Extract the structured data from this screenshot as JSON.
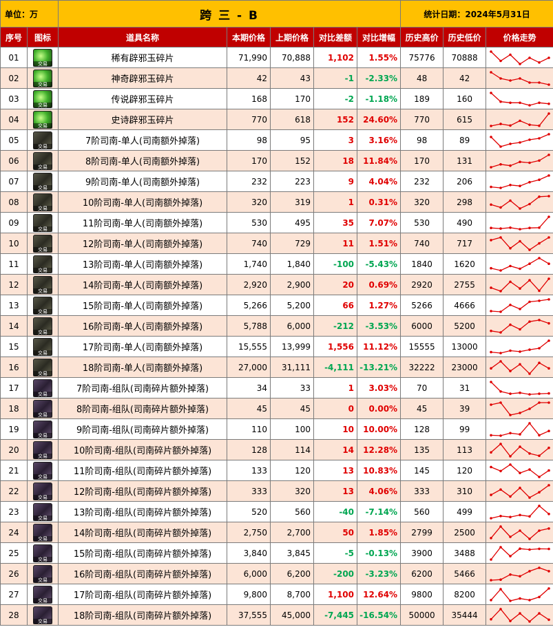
{
  "header": {
    "unit": "单位：万",
    "title": "跨 三 - B",
    "date": "统计日期：2024年5月31日"
  },
  "columns": [
    "序号",
    "图标",
    "道具名称",
    "本期价格",
    "上期价格",
    "对比差额",
    "对比增幅",
    "历史高价",
    "历史低价",
    "价格走势"
  ],
  "icon_label": "交易",
  "colors": {
    "header_bg": "#ffc000",
    "column_header_bg": "#c00000",
    "even_row_bg": "#fce4d6",
    "positive": "#e00000",
    "negative": "#00a651",
    "sparkline": "#e00000"
  },
  "rows": [
    {
      "no": "01",
      "icon": "gem-icon",
      "name": "稀有辟邪玉碎片",
      "cur": "71,990",
      "prev": "70,888",
      "diff": "1,102",
      "pct": "1.55%",
      "high": "75776",
      "low": "70888",
      "sign": "pos",
      "trend": [
        74,
        71,
        73,
        70,
        72,
        70.5,
        72
      ]
    },
    {
      "no": "02",
      "icon": "gem-icon",
      "name": "神奇辟邪玉碎片",
      "cur": "42",
      "prev": "43",
      "diff": "-1",
      "pct": "-2.33%",
      "high": "48",
      "low": "42",
      "sign": "neg",
      "trend": [
        48,
        45,
        44,
        45,
        43,
        43,
        42
      ]
    },
    {
      "no": "03",
      "icon": "gem-icon",
      "name": "传说辟邪玉碎片",
      "cur": "168",
      "prev": "170",
      "diff": "-2",
      "pct": "-1.18%",
      "high": "189",
      "low": "160",
      "sign": "neg",
      "trend": [
        189,
        172,
        170,
        170,
        165,
        170,
        168
      ]
    },
    {
      "no": "04",
      "icon": "gem-icon",
      "name": "史诗辟邪玉碎片",
      "cur": "770",
      "prev": "618",
      "diff": "152",
      "pct": "24.60%",
      "high": "770",
      "low": "615",
      "sign": "pos",
      "trend": [
        615,
        640,
        620,
        680,
        630,
        618,
        770
      ]
    },
    {
      "no": "05",
      "icon": "card-icon",
      "name": "7阶司南-单人(司南额外掉落)",
      "cur": "98",
      "prev": "95",
      "diff": "3",
      "pct": "3.16%",
      "high": "98",
      "low": "89",
      "sign": "pos",
      "trend": [
        96,
        89,
        91,
        92,
        94,
        95,
        98
      ]
    },
    {
      "no": "06",
      "icon": "card-icon",
      "name": "8阶司南-单人(司南额外掉落)",
      "cur": "170",
      "prev": "152",
      "diff": "18",
      "pct": "11.84%",
      "high": "170",
      "low": "131",
      "sign": "pos",
      "trend": [
        131,
        140,
        136,
        148,
        145,
        152,
        170
      ]
    },
    {
      "no": "07",
      "icon": "card-icon",
      "name": "9阶司南-单人(司南额外掉落)",
      "cur": "232",
      "prev": "223",
      "diff": "9",
      "pct": "4.04%",
      "high": "232",
      "low": "206",
      "sign": "pos",
      "trend": [
        208,
        206,
        212,
        210,
        218,
        223,
        232
      ]
    },
    {
      "no": "08",
      "icon": "card-icon",
      "name": "10阶司南-单人(司南额外掉落)",
      "cur": "320",
      "prev": "319",
      "diff": "1",
      "pct": "0.31%",
      "high": "320",
      "low": "298",
      "sign": "pos",
      "trend": [
        305,
        300,
        312,
        298,
        306,
        319,
        320
      ]
    },
    {
      "no": "09",
      "icon": "card-icon",
      "name": "11阶司南-单人(司南额外掉落)",
      "cur": "530",
      "prev": "495",
      "diff": "35",
      "pct": "7.07%",
      "high": "530",
      "low": "490",
      "sign": "pos",
      "trend": [
        494,
        492,
        495,
        490,
        494,
        495,
        530
      ]
    },
    {
      "no": "10",
      "icon": "card-icon",
      "name": "12阶司南-单人(司南额外掉落)",
      "cur": "740",
      "prev": "729",
      "diff": "11",
      "pct": "1.51%",
      "high": "740",
      "low": "717",
      "sign": "pos",
      "trend": [
        735,
        740,
        720,
        733,
        717,
        729,
        740
      ]
    },
    {
      "no": "11",
      "icon": "card-icon",
      "name": "13阶司南-单人(司南额外掉落)",
      "cur": "1,740",
      "prev": "1,840",
      "diff": "-100",
      "pct": "-5.43%",
      "high": "1840",
      "low": "1620",
      "sign": "neg",
      "trend": [
        1660,
        1620,
        1700,
        1650,
        1740,
        1840,
        1740
      ]
    },
    {
      "no": "12",
      "icon": "card-icon",
      "name": "14阶司南-单人(司南额外掉落)",
      "cur": "2,920",
      "prev": "2,900",
      "diff": "20",
      "pct": "0.69%",
      "high": "2920",
      "low": "2755",
      "sign": "pos",
      "trend": [
        2800,
        2755,
        2880,
        2790,
        2900,
        2760,
        2920
      ]
    },
    {
      "no": "13",
      "icon": "card-icon",
      "name": "15阶司南-单人(司南额外掉落)",
      "cur": "5,266",
      "prev": "5,200",
      "diff": "66",
      "pct": "1.27%",
      "high": "5266",
      "low": "4666",
      "sign": "pos",
      "trend": [
        4700,
        4666,
        5000,
        4800,
        5150,
        5200,
        5266
      ]
    },
    {
      "no": "14",
      "icon": "card-icon",
      "name": "16阶司南-单人(司南额外掉落)",
      "cur": "5,788",
      "prev": "6,000",
      "diff": "-212",
      "pct": "-3.53%",
      "high": "6000",
      "low": "5200",
      "sign": "neg",
      "trend": [
        5300,
        5200,
        5700,
        5400,
        5900,
        6000,
        5788
      ]
    },
    {
      "no": "15",
      "icon": "card-icon",
      "name": "17阶司南-单人(司南额外掉落)",
      "cur": "15,555",
      "prev": "13,999",
      "diff": "1,556",
      "pct": "11.12%",
      "high": "15555",
      "low": "13000",
      "sign": "pos",
      "trend": [
        13200,
        13000,
        13500,
        13300,
        13700,
        13999,
        15555
      ]
    },
    {
      "no": "16",
      "icon": "card-icon",
      "name": "18阶司南-单人(司南额外掉落)",
      "cur": "27,000",
      "prev": "31,111",
      "diff": "-4,111",
      "pct": "-13.21%",
      "high": "32222",
      "low": "23000",
      "sign": "neg",
      "trend": [
        27000,
        32222,
        25000,
        30000,
        23000,
        31111,
        27000
      ]
    },
    {
      "no": "17",
      "icon": "team-card-icon",
      "name": "7阶司南-组队(司南碎片额外掉落)",
      "cur": "34",
      "prev": "33",
      "diff": "1",
      "pct": "3.03%",
      "high": "70",
      "low": "31",
      "sign": "pos",
      "trend": [
        70,
        40,
        33,
        36,
        31,
        33,
        34
      ]
    },
    {
      "no": "18",
      "icon": "team-card-icon",
      "name": "8阶司南-组队(司南碎片额外掉落)",
      "cur": "45",
      "prev": "45",
      "diff": "0",
      "pct": "0.00%",
      "high": "45",
      "low": "39",
      "sign": "zero",
      "trend": [
        44,
        45,
        39,
        40,
        42,
        45,
        45
      ]
    },
    {
      "no": "19",
      "icon": "team-card-icon",
      "name": "9阶司南-组队(司南碎片额外掉落)",
      "cur": "110",
      "prev": "100",
      "diff": "10",
      "pct": "10.00%",
      "high": "128",
      "low": "99",
      "sign": "pos",
      "trend": [
        100,
        99,
        105,
        102,
        128,
        100,
        110
      ]
    },
    {
      "no": "20",
      "icon": "team-card-icon",
      "name": "10阶司南-组队(司南碎片额外掉落)",
      "cur": "128",
      "prev": "114",
      "diff": "14",
      "pct": "12.28%",
      "high": "135",
      "low": "113",
      "sign": "pos",
      "trend": [
        120,
        135,
        113,
        130,
        118,
        114,
        128
      ]
    },
    {
      "no": "21",
      "icon": "team-card-icon",
      "name": "11阶司南-组队(司南碎片额外掉落)",
      "cur": "133",
      "prev": "120",
      "diff": "13",
      "pct": "10.83%",
      "high": "145",
      "low": "120",
      "sign": "pos",
      "trend": [
        140,
        132,
        145,
        128,
        135,
        120,
        133
      ]
    },
    {
      "no": "22",
      "icon": "team-card-icon",
      "name": "12阶司南-组队(司南碎片额外掉落)",
      "cur": "333",
      "prev": "320",
      "diff": "13",
      "pct": "4.06%",
      "high": "333",
      "low": "310",
      "sign": "pos",
      "trend": [
        315,
        325,
        312,
        328,
        310,
        320,
        333
      ]
    },
    {
      "no": "23",
      "icon": "team-card-icon",
      "name": "13阶司南-组队(司南碎片额外掉落)",
      "cur": "520",
      "prev": "560",
      "diff": "-40",
      "pct": "-7.14%",
      "high": "560",
      "low": "499",
      "sign": "neg",
      "trend": [
        499,
        510,
        505,
        515,
        508,
        560,
        520
      ]
    },
    {
      "no": "24",
      "icon": "team-card-icon",
      "name": "14阶司南-组队(司南碎片额外掉落)",
      "cur": "2,750",
      "prev": "2,700",
      "diff": "50",
      "pct": "1.85%",
      "high": "2799",
      "low": "2500",
      "sign": "pos",
      "trend": [
        2520,
        2799,
        2550,
        2700,
        2500,
        2700,
        2750
      ]
    },
    {
      "no": "25",
      "icon": "team-card-icon",
      "name": "15阶司南-组队(司南碎片额外掉落)",
      "cur": "3,840",
      "prev": "3,845",
      "diff": "-5",
      "pct": "-0.13%",
      "high": "3900",
      "low": "3488",
      "sign": "neg",
      "trend": [
        3488,
        3900,
        3600,
        3850,
        3820,
        3845,
        3840
      ]
    },
    {
      "no": "26",
      "icon": "team-card-icon",
      "name": "16阶司南-组队(司南碎片额外掉落)",
      "cur": "6,000",
      "prev": "6,200",
      "diff": "-200",
      "pct": "-3.23%",
      "high": "6200",
      "low": "5466",
      "sign": "neg",
      "trend": [
        5466,
        5500,
        5800,
        5700,
        6000,
        6200,
        6000
      ]
    },
    {
      "no": "27",
      "icon": "team-card-icon",
      "name": "17阶司南-组队(司南碎片额外掉落)",
      "cur": "9,800",
      "prev": "8,700",
      "diff": "1,100",
      "pct": "12.64%",
      "high": "9800",
      "low": "8200",
      "sign": "pos",
      "trend": [
        8300,
        9700,
        8200,
        8500,
        8300,
        8700,
        9800
      ]
    },
    {
      "no": "28",
      "icon": "team-card-icon",
      "name": "18阶司南-组队(司南碎片额外掉落)",
      "cur": "37,555",
      "prev": "45,000",
      "diff": "-7,445",
      "pct": "-16.54%",
      "high": "50000",
      "low": "35444",
      "sign": "neg",
      "trend": [
        38000,
        50000,
        36000,
        45000,
        35444,
        45000,
        37555
      ]
    }
  ]
}
